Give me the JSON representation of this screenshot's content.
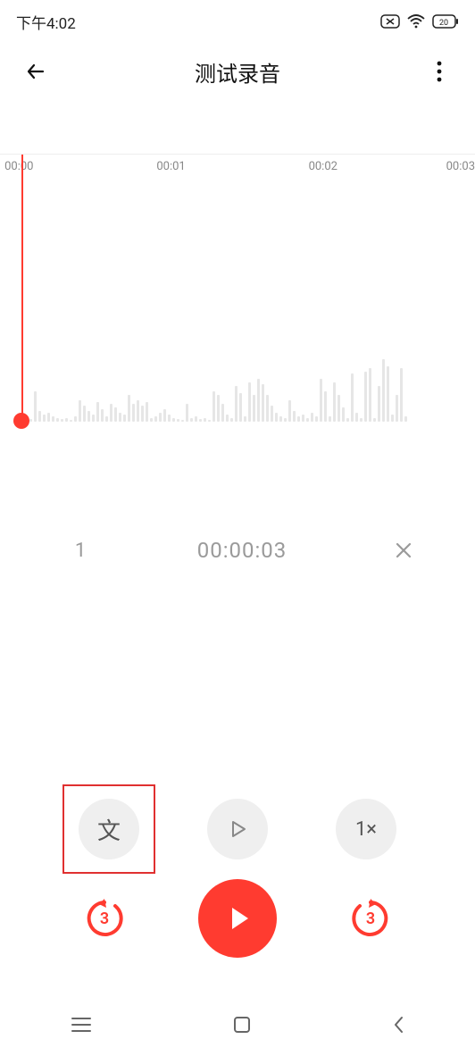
{
  "status": {
    "time": "下午4:02",
    "battery_pct": 20
  },
  "header": {
    "title": "测试录音"
  },
  "timeline": {
    "ticks": [
      "00:00",
      "00:01",
      "00:02",
      "00:03"
    ],
    "tick_positions_pct": [
      4,
      36,
      68,
      100
    ],
    "wave_heights": [
      4,
      3,
      34,
      12,
      8,
      10,
      6,
      4,
      3,
      4,
      2,
      6,
      24,
      18,
      12,
      8,
      22,
      14,
      6,
      20,
      16,
      10,
      8,
      30,
      20,
      24,
      18,
      22,
      4,
      6,
      10,
      14,
      8,
      4,
      3,
      2,
      20,
      4,
      6,
      3,
      4,
      2,
      34,
      30,
      20,
      8,
      4,
      40,
      32,
      6,
      44,
      30,
      48,
      42,
      30,
      18,
      10,
      6,
      4,
      24,
      12,
      6,
      8,
      4,
      10,
      6,
      48,
      34,
      6,
      44,
      30,
      16,
      4,
      54,
      10,
      4,
      56,
      60,
      4,
      40,
      70,
      62,
      8,
      30,
      60,
      6
    ],
    "playhead_pct": 4.5
  },
  "segment": {
    "index": "1",
    "time": "00:00:03"
  },
  "controls": {
    "text_label": "文",
    "speed_label": "1×",
    "skip_back_seconds": "3",
    "skip_fwd_seconds": "3"
  },
  "accent_color": "#ff3b30"
}
